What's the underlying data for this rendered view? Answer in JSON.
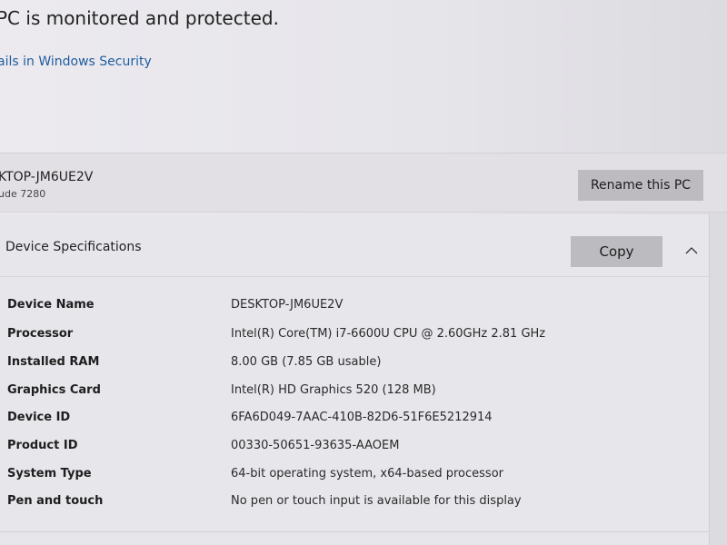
{
  "status": {
    "title": "PC is monitored and protected.",
    "link": "ails in Windows Security"
  },
  "pc": {
    "name": "KTOP-JM6UE2V",
    "model": "ude 7280",
    "rename_label": "Rename this PC"
  },
  "specs": {
    "title": "Device Specifications",
    "copy_label": "Copy",
    "rows": [
      {
        "label": "Device Name",
        "value": "DESKTOP-JM6UE2V"
      },
      {
        "label": "Processor",
        "value": "Intel(R) Core(TM) i7-6600U CPU @ 2.60GHz   2.81 GHz"
      },
      {
        "label": "Installed RAM",
        "value": "8.00 GB (7.85 GB usable)"
      },
      {
        "label": "Graphics Card",
        "value": "Intel(R) HD Graphics 520 (128 MB)"
      },
      {
        "label": "Device ID",
        "value": "6FA6D049-7AAC-410B-82D6-51F6E5212914"
      },
      {
        "label": "Product ID",
        "value": "00330-50651-93635-AAOEM"
      },
      {
        "label": "System Type",
        "value": "64-bit operating system, x64-based processor"
      },
      {
        "label": "Pen and touch",
        "value": "No pen or touch input is available for this display"
      }
    ]
  },
  "icons": {
    "collapse": "chevron-up-icon"
  }
}
